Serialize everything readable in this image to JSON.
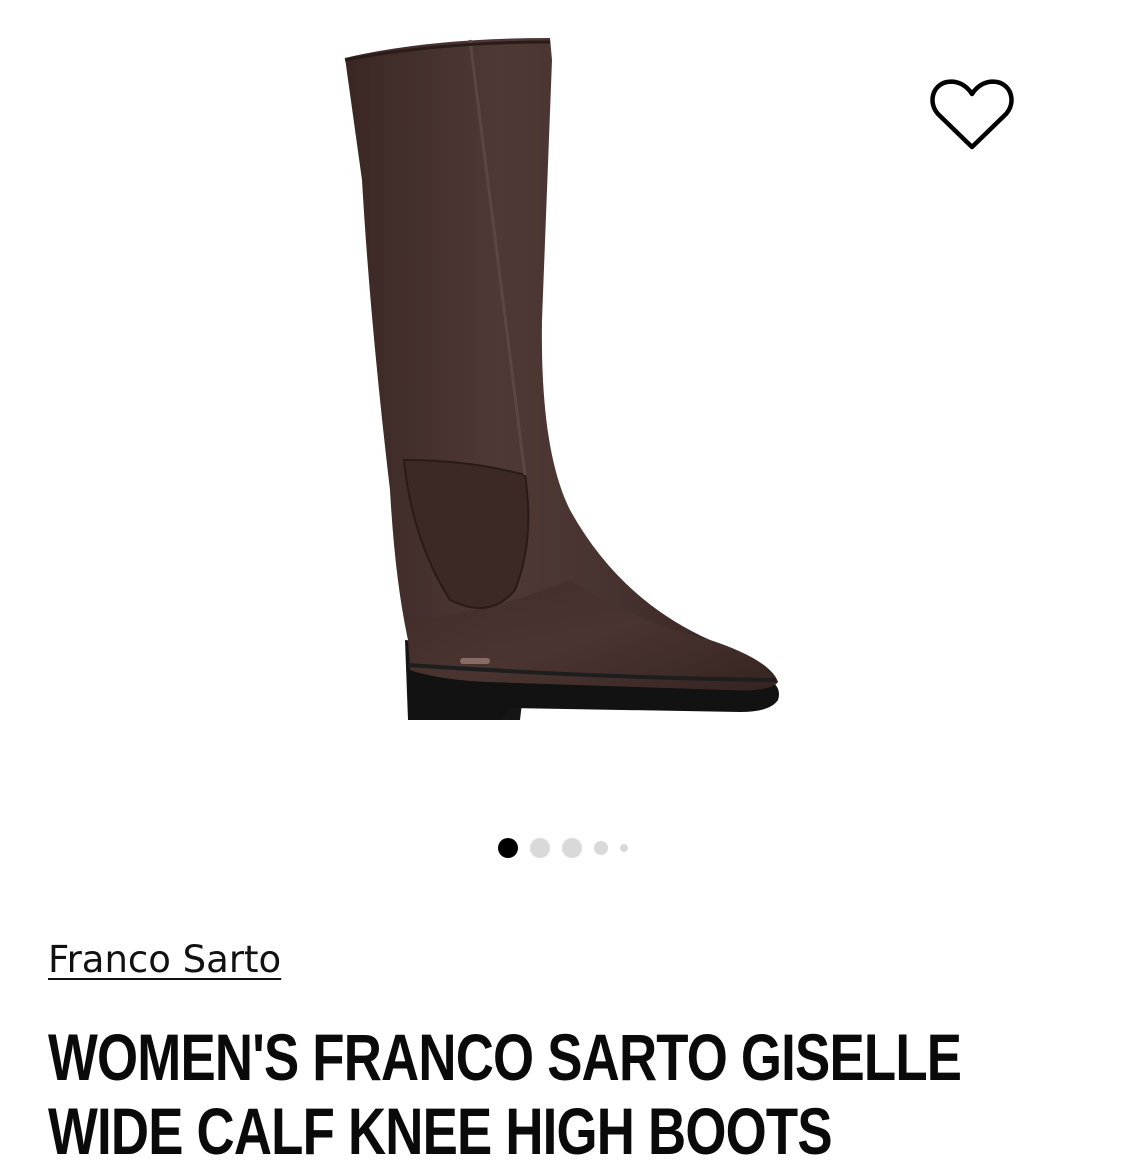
{
  "product": {
    "brand": "Franco Sarto",
    "title": "WOMEN'S FRANCO SARTO GISELLE WIDE CALF KNEE HIGH BOOTS",
    "image": {
      "subject": "knee-high-boot",
      "colors": {
        "leather": "#3f2b27",
        "leather_highlight": "#5b4340",
        "sole": "#141414"
      }
    }
  },
  "wishlist": {
    "icon": "heart-outline-icon"
  },
  "gallery": {
    "total_images": 5,
    "active_index": 0
  }
}
